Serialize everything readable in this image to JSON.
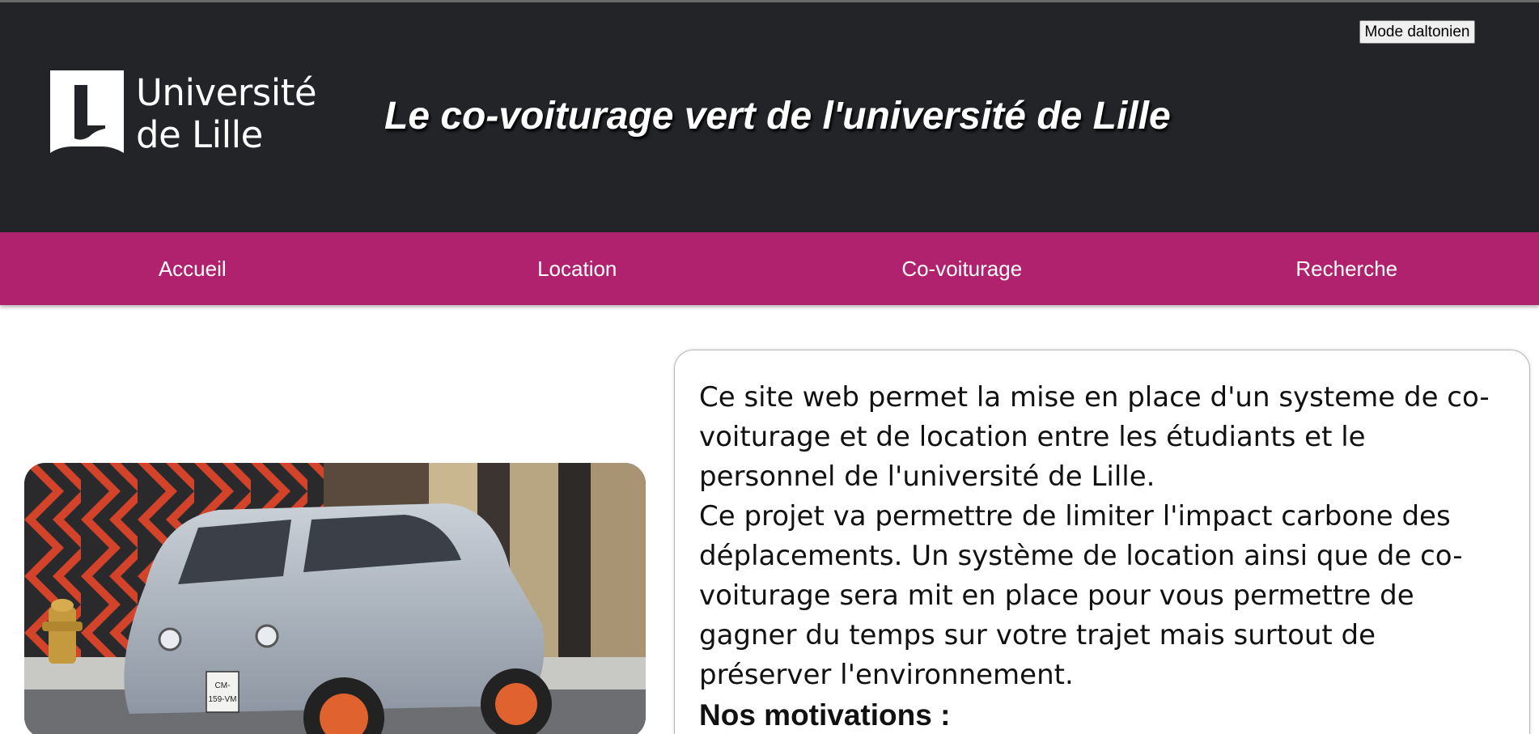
{
  "header": {
    "logo_text_line1": "Université",
    "logo_text_line2": "de Lille",
    "title": "Le co-voiturage vert de l'université de Lille",
    "mode_button_label": "Mode daltonien"
  },
  "nav": {
    "items": [
      {
        "label": "Accueil"
      },
      {
        "label": "Location"
      },
      {
        "label": "Co-voiturage"
      },
      {
        "label": "Recherche"
      }
    ]
  },
  "main": {
    "car_plate_line1": "CM-",
    "car_plate_line2": "159-VM",
    "paragraph1": "Ce site web permet la mise en place d'un systeme de co-voiturage et de location entre les étudiants et le personnel de l'université de Lille.",
    "paragraph2": "Ce projet va permettre de limiter l'impact carbone des déplacements. Un système de location ainsi que de co-voiturage sera mit en place pour vous permettre de gagner du temps sur votre trajet mais surtout de préserver l'environnement.",
    "motivations_heading": "Nos motivations :"
  },
  "colors": {
    "header_bg": "#222428",
    "nav_bg": "#b0226e",
    "text": "#111111"
  }
}
